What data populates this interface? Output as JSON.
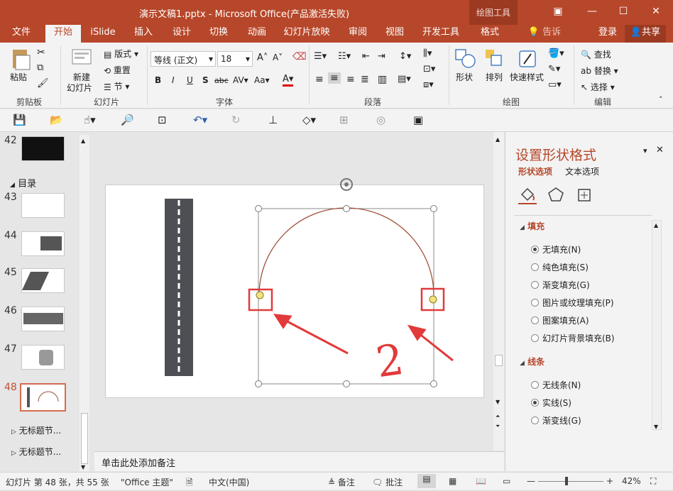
{
  "window": {
    "title": "演示文稿1.pptx - Microsoft Office(产品激活失败)",
    "context_tab": "绘图工具"
  },
  "tabs": [
    "文件",
    "开始",
    "iSlide",
    "插入",
    "设计",
    "切换",
    "动画",
    "幻灯片放映",
    "审阅",
    "视图",
    "开发工具",
    "格式"
  ],
  "tell_me": "告诉我...",
  "signin": "登录",
  "share": "共享",
  "ribbon": {
    "clipboard": {
      "paste": "粘贴",
      "label": "剪贴板"
    },
    "slides": {
      "new_slide": "新建",
      "new_slide2": "幻灯片",
      "layout": "版式",
      "reset": "重置",
      "section": "节",
      "label": "幻灯片"
    },
    "font": {
      "name": "等线 (正文)",
      "size": "18",
      "bold": "B",
      "italic": "I",
      "underline": "U",
      "shadow": "S",
      "strike": "abc",
      "spacing": "AV",
      "case": "Aa",
      "color": "A",
      "label": "字体"
    },
    "paragraph": {
      "label": "段落"
    },
    "drawing": {
      "shape": "形状",
      "arrange": "排列",
      "quick_styles": "快速样式",
      "label": "绘图"
    },
    "editing": {
      "find": "查找",
      "replace": "替换",
      "select": "选择",
      "label": "编辑"
    }
  },
  "thumbs": {
    "section_name": "目录",
    "numbers": [
      "42",
      "43",
      "44",
      "45",
      "46",
      "47",
      "48"
    ],
    "untitled1": "无标题节...",
    "untitled2": "无标题节..."
  },
  "notes_placeholder": "单击此处添加备注",
  "annotation": "2",
  "pane": {
    "title": "设置形状格式",
    "tab_shape": "形状选项",
    "tab_text": "文本选项",
    "fill_section": "填充",
    "fill_options": [
      "无填充(N)",
      "纯色填充(S)",
      "渐变填充(G)",
      "图片或纹理填充(P)",
      "图案填充(A)",
      "幻灯片背景填充(B)"
    ],
    "line_section": "线条",
    "line_options": [
      "无线条(N)",
      "实线(S)",
      "渐变线(G)"
    ]
  },
  "status": {
    "slide_info": "幻灯片 第 48 张，共 55 张",
    "theme": "\"Office 主题\"",
    "language": "中文(中国)",
    "notes": "备注",
    "comments": "批注",
    "zoom": "42%"
  },
  "colors": {
    "accent": "#b7472a",
    "arrow_red": "#e23a3a",
    "arc": "#a0523c"
  }
}
